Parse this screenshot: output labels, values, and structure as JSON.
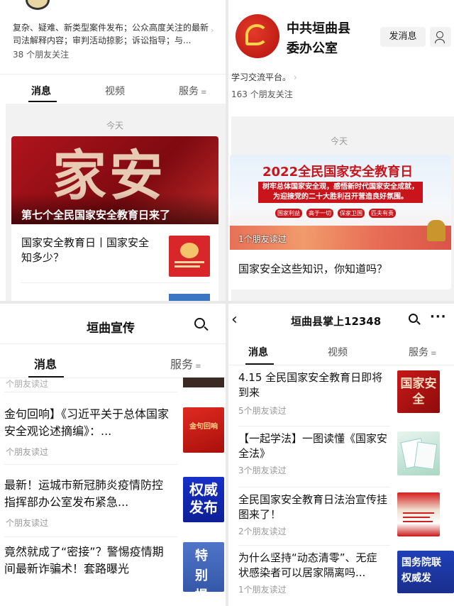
{
  "q1": {
    "desc": "复杂、疑难、新类型案件发布；公众高度关注的最新司法解释内容；审判活动掠影；诉讼指导；与...",
    "followers": "38 个朋友关注",
    "tabs": [
      "消息",
      "视频",
      "服务"
    ],
    "date": "今天",
    "banner_title": "第七个全民国家安全教育日来了",
    "banner_art": "家安",
    "article_title": "国家安全教育日丨国家安全知多少？"
  },
  "q2": {
    "name_line1": "中共垣曲县",
    "name_line2": "委办公室",
    "send_btn": "发消息",
    "desc": "学习交流平台。",
    "followers": "163 个朋友关注",
    "date": "今天",
    "poster_title": "2022全民国家安全教育日",
    "poster_sub": "树牢总体国家安全观，感悟新时代国家安全成就，为迎接党的二十大胜利召开营造良好氛围。",
    "poster_tags": [
      "国家利益",
      "高于一切",
      "保家卫国",
      "匹夫有责"
    ],
    "read_overlay": "1个朋友读过",
    "article_title": "国家安全这些知识，你知道吗？"
  },
  "q3": {
    "title": "垣曲宣传",
    "tabs": [
      "消息",
      "服务"
    ],
    "top_reads": "个朋友读过",
    "items": [
      {
        "title": "金句回响】《习近平关于总体国家安全观论述摘编》：...",
        "reads": "个朋友读过",
        "thumb": "金句回响"
      },
      {
        "title": "最新！运城市新冠肺炎疫情防控指挥部办公室发布紧急...",
        "reads": "个朋友读过",
        "thumb": "权威发布"
      },
      {
        "title": "竟然就成了“密接”？警惕疫情期间最新诈骗术！套路曝光",
        "reads": "",
        "thumb": "特别提醒"
      }
    ]
  },
  "q4": {
    "title": "垣曲县掌上12348",
    "tabs": [
      "消息",
      "视频",
      "服务"
    ],
    "items": [
      {
        "title": "4.15 全民国家安全教育日即将到来",
        "reads": "5个朋友读过",
        "thumb": "国家安全"
      },
      {
        "title": "【一起学法】一图读懂《国家安全法》",
        "reads": "3个朋友读过",
        "thumb": ""
      },
      {
        "title": "全民国家安全教育日法治宣传挂图来了！",
        "reads": "2个朋友读过",
        "thumb": ""
      },
      {
        "title": "为什么坚持“动态清零”、无症状感染者可以居家隔离吗...",
        "reads": "1个朋友读过",
        "thumb": "国务院联权威发"
      }
    ]
  }
}
